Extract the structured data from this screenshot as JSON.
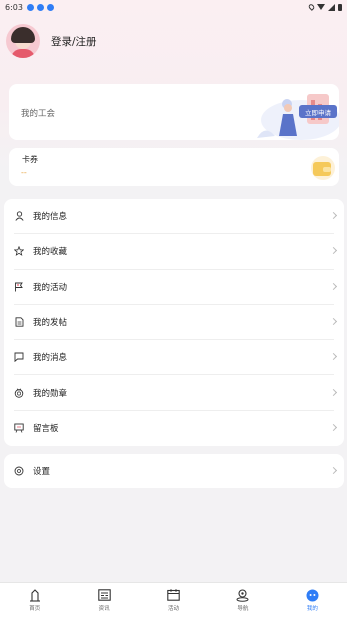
{
  "status_bar": {
    "time": "6:03"
  },
  "profile": {
    "login_text": "登录/注册"
  },
  "union_card": {
    "title": "我的工会",
    "button_label": "立即申请"
  },
  "coupon_card": {
    "title": "卡券",
    "value": "--"
  },
  "menu": [
    {
      "label": "我的信息",
      "icon": "user-icon"
    },
    {
      "label": "我的收藏",
      "icon": "star-icon"
    },
    {
      "label": "我的活动",
      "icon": "flag-icon"
    },
    {
      "label": "我的发帖",
      "icon": "document-icon"
    },
    {
      "label": "我的消息",
      "icon": "message-icon"
    },
    {
      "label": "我的勋章",
      "icon": "medal-icon"
    },
    {
      "label": "留言板",
      "icon": "board-icon"
    }
  ],
  "settings": {
    "label": "设置",
    "icon": "settings-icon"
  },
  "tabs": [
    {
      "label": "首页",
      "icon": "home-icon"
    },
    {
      "label": "资讯",
      "icon": "news-icon"
    },
    {
      "label": "活动",
      "icon": "calendar-icon"
    },
    {
      "label": "导航",
      "icon": "location-icon"
    },
    {
      "label": "我的",
      "icon": "profile-icon"
    }
  ],
  "colors": {
    "accent": "#2f7df6",
    "button": "#5a73c9",
    "coupon_value": "#e6a23c"
  }
}
